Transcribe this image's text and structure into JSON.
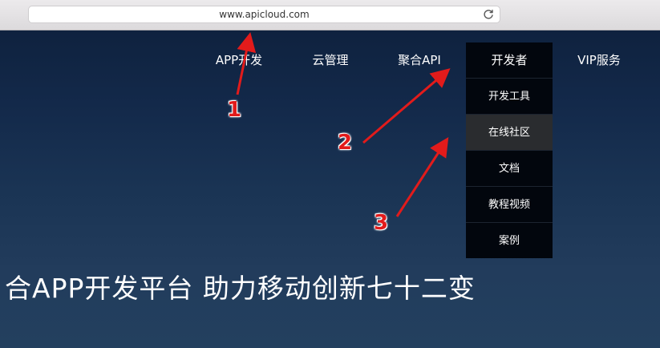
{
  "browser": {
    "url": "www.apicloud.com"
  },
  "nav": {
    "items": [
      {
        "label": "APP开发"
      },
      {
        "label": "云管理"
      },
      {
        "label": "聚合API"
      },
      {
        "label": "开发者"
      },
      {
        "label": "VIP服务"
      }
    ],
    "dropdown": [
      {
        "label": "开发工具"
      },
      {
        "label": "在线社区"
      },
      {
        "label": "文档"
      },
      {
        "label": "教程视频"
      },
      {
        "label": "案例"
      }
    ]
  },
  "hero": {
    "title": "合APP开发平台 助力移动创新七十二变"
  },
  "annotations": {
    "markers": [
      "1",
      "2",
      "3"
    ],
    "color": "#e21b1b"
  }
}
